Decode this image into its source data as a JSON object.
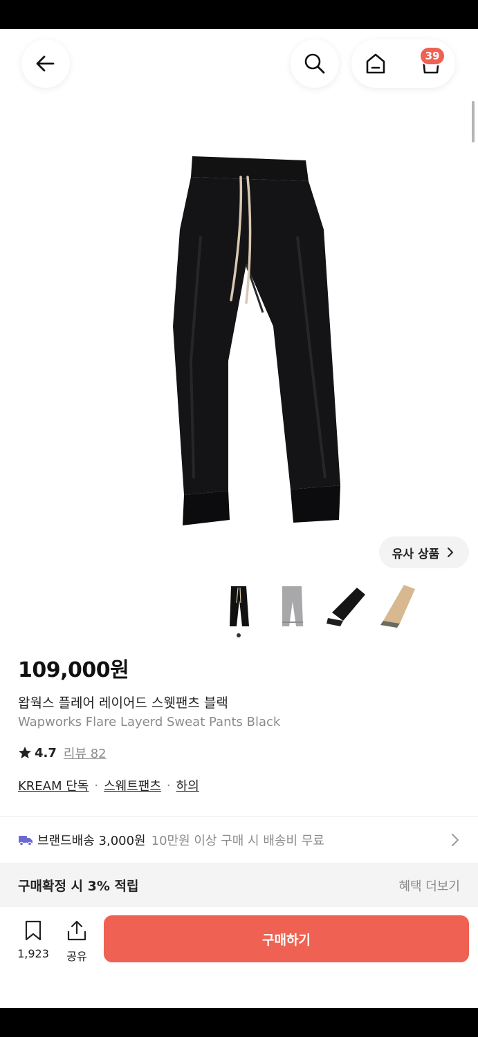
{
  "header": {
    "cart_count": "39"
  },
  "similar_button": "유사 상품",
  "product": {
    "price": "109,000원",
    "name_ko": "왑웍스 플레어 레이어드 스웻팬츠 블랙",
    "name_en": "Wapworks Flare Layerd Sweat Pants Black",
    "rating": "4.7",
    "reviews": "리뷰 82",
    "tags": [
      "KREAM 단독",
      "스웨트팬츠",
      "하의"
    ],
    "tag_separator": "·"
  },
  "thumbnails": [
    "black",
    "gray",
    "black-folded",
    "beige"
  ],
  "shipping": {
    "label": "브랜드배송 3,000원",
    "note": "10만원 이상 구매 시 배송비 무료"
  },
  "benefit": {
    "label": "구매확정 시 3% 적립",
    "more": "혜택 더보기"
  },
  "bottom": {
    "bookmark_count": "1,923",
    "share_label": "공유",
    "buy_label": "구매하기"
  },
  "colors": {
    "accent": "#ef6253",
    "shipping_icon": "#6d68d8"
  },
  "icons": [
    "back-arrow-icon",
    "search-icon",
    "home-icon",
    "cart-icon",
    "chevron-right-icon",
    "truck-icon",
    "bookmark-icon",
    "share-icon",
    "star-icon"
  ]
}
